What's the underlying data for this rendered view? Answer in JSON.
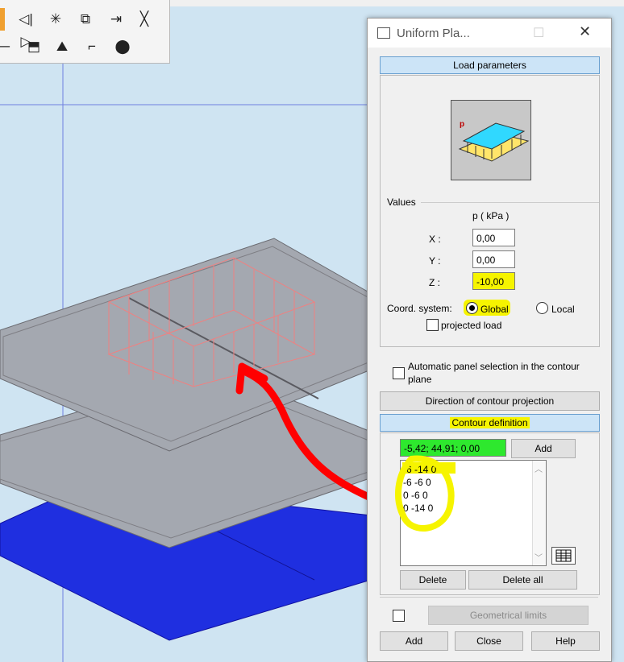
{
  "dialog": {
    "title": "Uniform Pla...",
    "sections": {
      "load_parameters": "Load parameters",
      "values": "Values",
      "contour_definition": "Contour definition"
    },
    "units_label": "p    ( kPa )",
    "fields": [
      {
        "label": "X :",
        "value": "0,00"
      },
      {
        "label": "Y :",
        "value": "0,00"
      },
      {
        "label": "Z :",
        "value": "-10,00"
      }
    ],
    "coord_system_label": "Coord. system:",
    "coord_options": {
      "global": "Global",
      "local": "Local"
    },
    "projected_load_label": "projected load",
    "auto_panel_label_1": "Automatic panel selection in the contour",
    "auto_panel_label_2": "plane",
    "direction_button": "Direction of contour projection",
    "point_input": "-5,42; 44,91; 0,00",
    "add_point_button": "Add",
    "contour_points": [
      "-6 -14 0",
      "-6 -6 0",
      "0 -6 0",
      "0 -14 0"
    ],
    "delete_button": "Delete",
    "delete_all_button": "Delete all",
    "geometrical_limits_button": "Geometrical limits",
    "footer": {
      "add": "Add",
      "close": "Close",
      "help": "Help"
    },
    "icon_letter": "p"
  },
  "colors": {
    "highlight": "#f6f400",
    "point_input_bg": "#2ee82e",
    "arrow": "#ff0000",
    "section_bar": "#cce4f7"
  }
}
